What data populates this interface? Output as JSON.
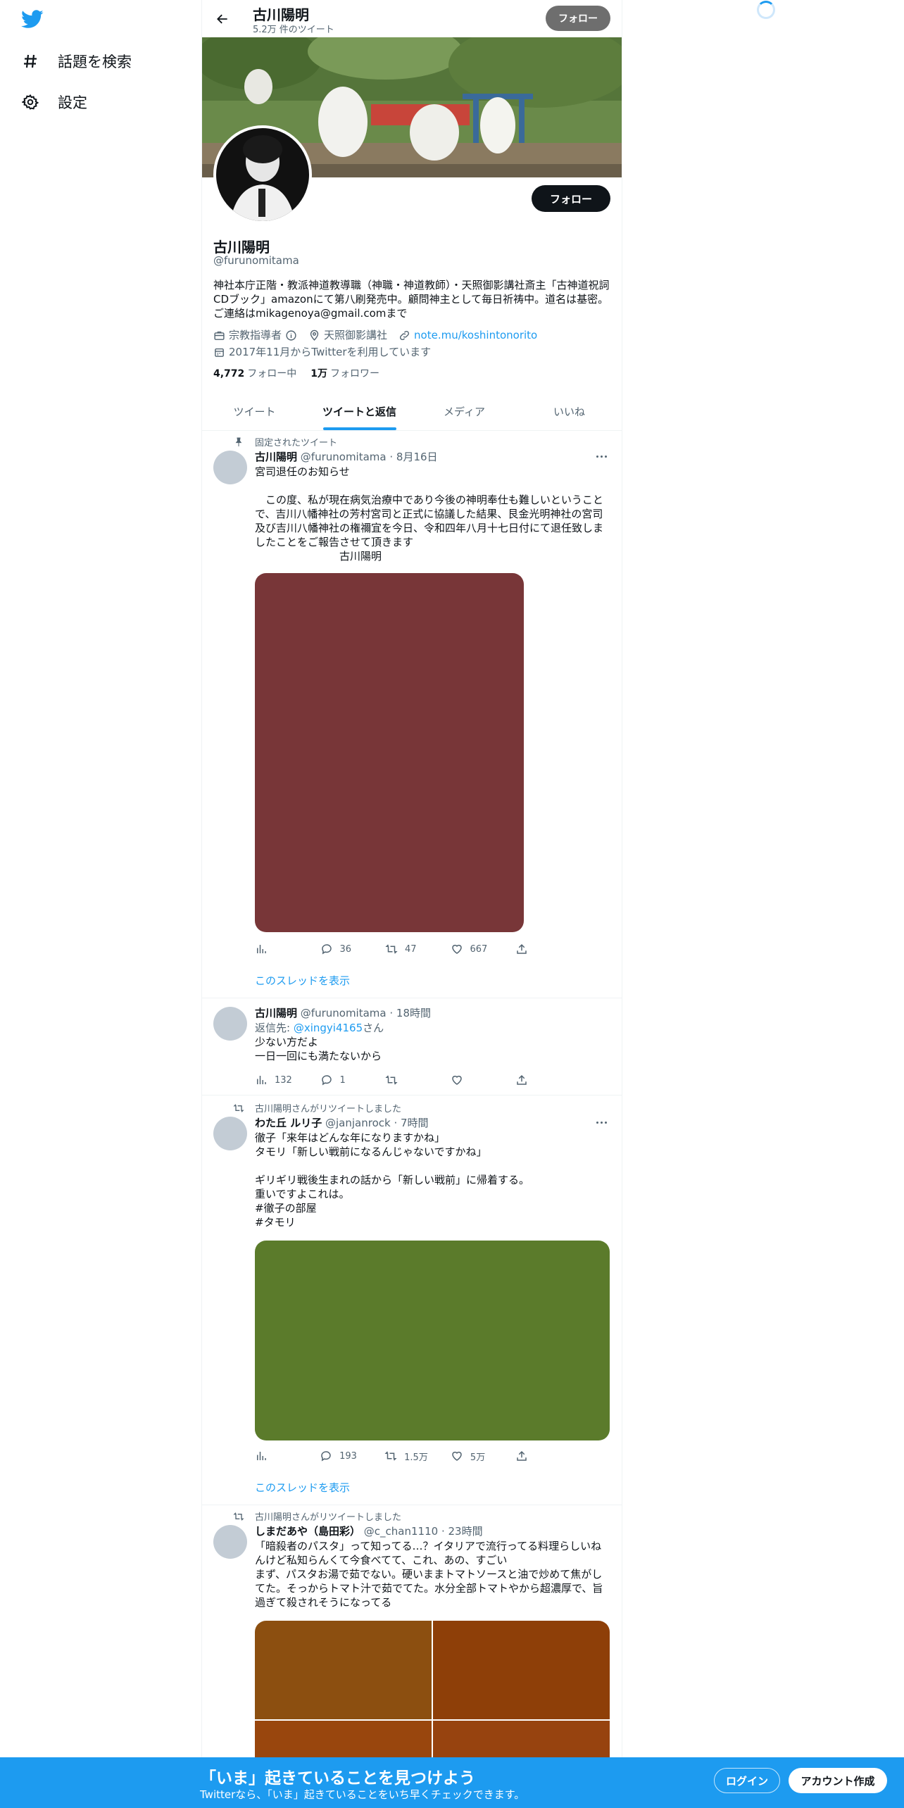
{
  "sidebar": {
    "logo": "twitter-bird-icon",
    "items": [
      {
        "label": "話題を検索",
        "icon": "hashtag-icon"
      },
      {
        "label": "設定",
        "icon": "gear-icon"
      }
    ]
  },
  "header": {
    "name": "古川陽明",
    "tweet_count": "5.2万 件のツイート",
    "follow_label": "フォロー"
  },
  "profile": {
    "follow_label": "フォロー",
    "name": "古川陽明",
    "handle": "@furunomitama",
    "bio": "神社本庁正階・教派神道教導職（神職・神道教師）・天照御影講社斎主「古神道祝詞CDブック」amazonにて第八刷発売中。顧問神主として毎日祈祷中。道名は基密。ご連絡はmikagenoya@gmail.comまで",
    "category": "宗教指導者",
    "location": "天照御影講社",
    "url": "note.mu/koshintonorito",
    "joined": "2017年11月からTwitterを利用しています",
    "following_count": "4,772",
    "following_label": "フォロー中",
    "followers_count": "1万",
    "followers_label": "フォロワー"
  },
  "tabs": [
    "ツイート",
    "ツイートと返信",
    "メディア",
    "いいね"
  ],
  "active_tab": 1,
  "tweets": [
    {
      "context": "固定されたツイート",
      "name": "古川陽明",
      "handle": "@furunomitama",
      "time": "8月16日",
      "text": "宮司退任のお知らせ\n\n　この度、私が現在病気治療中であり今後の神明奉仕も難しいということで、吉川八幡神社の芳村宮司と正式に協議した結果、艮金光明神社の宮司及び吉川八幡神社の権禰宜を今日、令和四年八月十七日付にて退任致しましたことをご報告させて頂きます\n　　　　　　　　古川陽明",
      "media_color": "#783638",
      "replies": "36",
      "retweets": "47",
      "likes": "667",
      "thread": "このスレッドを表示"
    },
    {
      "name": "古川陽明",
      "handle": "@furunomitama",
      "time": "18時間",
      "reply_prefix": "返信先: ",
      "reply_to": "@xingyi4165",
      "reply_suffix": "さん",
      "text": "少ない方だよ\n一日一回にも満たないから",
      "views": "132",
      "replies": "1",
      "retweets": "",
      "likes": ""
    },
    {
      "context": "古川陽明さんがリツイートしました",
      "name": "わた丘 ルリ子",
      "handle": "@janjanrock",
      "time": "7時間",
      "text": "徹子「来年はどんな年になりますかね」\nタモリ「新しい戦前になるんじゃないですかね」\n\nギリギリ戦後生まれの話から「新しい戦前」に帰着する。\n重いですよこれは。",
      "hashtags": [
        "#徹子の部屋",
        "#タモリ"
      ],
      "media_color": "#5b7b2b",
      "replies": "193",
      "retweets": "1.5万",
      "likes": "5万",
      "thread": "このスレッドを表示"
    },
    {
      "context": "古川陽明さんがリツイートしました",
      "name": "しまだあや（島田彩）",
      "handle": "@c_chan1110",
      "time": "23時間",
      "text": "「暗殺者のパスタ」って知ってる…？イタリアで流行ってる料理らしいねんけど私知らんくて今食べてて、これ、あの、すごい\nまず、パスタお湯で茹でない。硬いままトマトソースと油で炒めて焦がしてた。そっからトマト汁で茹でてた。水分全部トマトやから超濃厚で、旨過ぎて殺されそうになってる",
      "media_colors": [
        "#8c4f10",
        "#8e3f08",
        "#99460d",
        "#97430f"
      ]
    }
  ],
  "bottom_bar": {
    "title": "「いま」起きていることを見つけよう",
    "subtitle": "Twitterなら、「いま」起きていることをいち早くチェックできます。",
    "login": "ログイン",
    "signup": "アカウント作成"
  }
}
